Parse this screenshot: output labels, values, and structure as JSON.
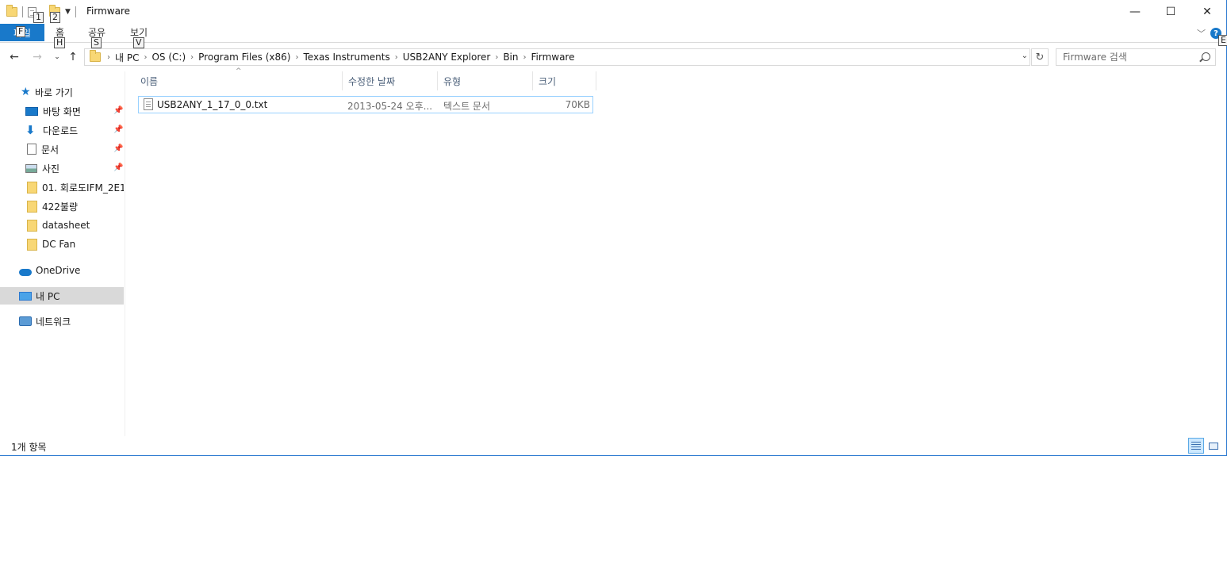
{
  "window": {
    "title": "Firmware",
    "quick_access_keytips": [
      "1",
      "2"
    ],
    "controls": {
      "minimize": "—",
      "maximize": "☐",
      "close": "✕"
    }
  },
  "ribbon": {
    "tabs": [
      {
        "label": "파일",
        "keytip": "F"
      },
      {
        "label": "홈",
        "keytip": "H"
      },
      {
        "label": "공유",
        "keytip": "S"
      },
      {
        "label": "보기",
        "keytip": "V"
      }
    ],
    "help_keytip": "E"
  },
  "navigation": {
    "breadcrumbs": [
      "내 PC",
      "OS (C:)",
      "Program Files (x86)",
      "Texas Instruments",
      "USB2ANY Explorer",
      "Bin",
      "Firmware"
    ],
    "search_placeholder": "Firmware 검색"
  },
  "sidebar": {
    "quick_access": {
      "label": "바로 가기",
      "icon": "star-icon"
    },
    "items": [
      {
        "label": "바탕 화면",
        "icon": "desktop-icon",
        "pinned": true
      },
      {
        "label": "다운로드",
        "icon": "download-icon",
        "pinned": true
      },
      {
        "label": "문서",
        "icon": "documents-icon",
        "pinned": true
      },
      {
        "label": "사진",
        "icon": "pictures-icon",
        "pinned": true
      },
      {
        "label": "01. 회로도IFM_2E1",
        "icon": "folder-icon",
        "pinned": false
      },
      {
        "label": "422불량",
        "icon": "folder-icon",
        "pinned": false
      },
      {
        "label": "datasheet",
        "icon": "folder-icon",
        "pinned": false
      },
      {
        "label": "DC Fan",
        "icon": "folder-icon",
        "pinned": false
      }
    ],
    "onedrive": "OneDrive",
    "this_pc": "내 PC",
    "network": "네트워크"
  },
  "file_list": {
    "columns": [
      "이름",
      "수정한 날짜",
      "유형",
      "크기"
    ],
    "rows": [
      {
        "name": "USB2ANY_1_17_0_0.txt",
        "modified": "2013-05-24 오후...",
        "type": "텍스트 문서",
        "size": "70KB"
      }
    ]
  },
  "status": {
    "item_count": "1개 항목"
  }
}
